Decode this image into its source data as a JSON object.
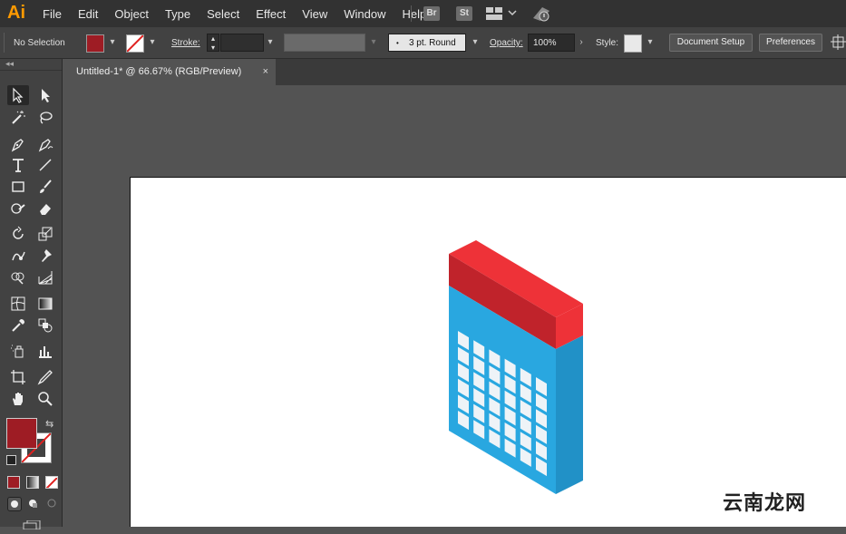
{
  "app": {
    "logo": "Ai"
  },
  "menu": [
    "File",
    "Edit",
    "Object",
    "Type",
    "Select",
    "Effect",
    "View",
    "Window",
    "Help"
  ],
  "menu_icons": {
    "bridge": "Br",
    "stock": "St"
  },
  "options": {
    "selection_label": "No Selection",
    "stroke_label": "Stroke:",
    "brush_value": "3 pt. Round",
    "opacity_label": "Opacity:",
    "opacity_value": "100%",
    "style_label": "Style:",
    "document_setup": "Document Setup",
    "preferences": "Preferences"
  },
  "tab": {
    "title": "Untitled-1* @ 66.67% (RGB/Preview)",
    "close": "×"
  },
  "watermark": "云南龙网",
  "colors": {
    "fill": "#9e1c24",
    "red_top": "#ee3238",
    "red_side": "#c0232b",
    "blue_front": "#29a7e0",
    "blue_side": "#2191c7",
    "window": "#eef3f7"
  }
}
